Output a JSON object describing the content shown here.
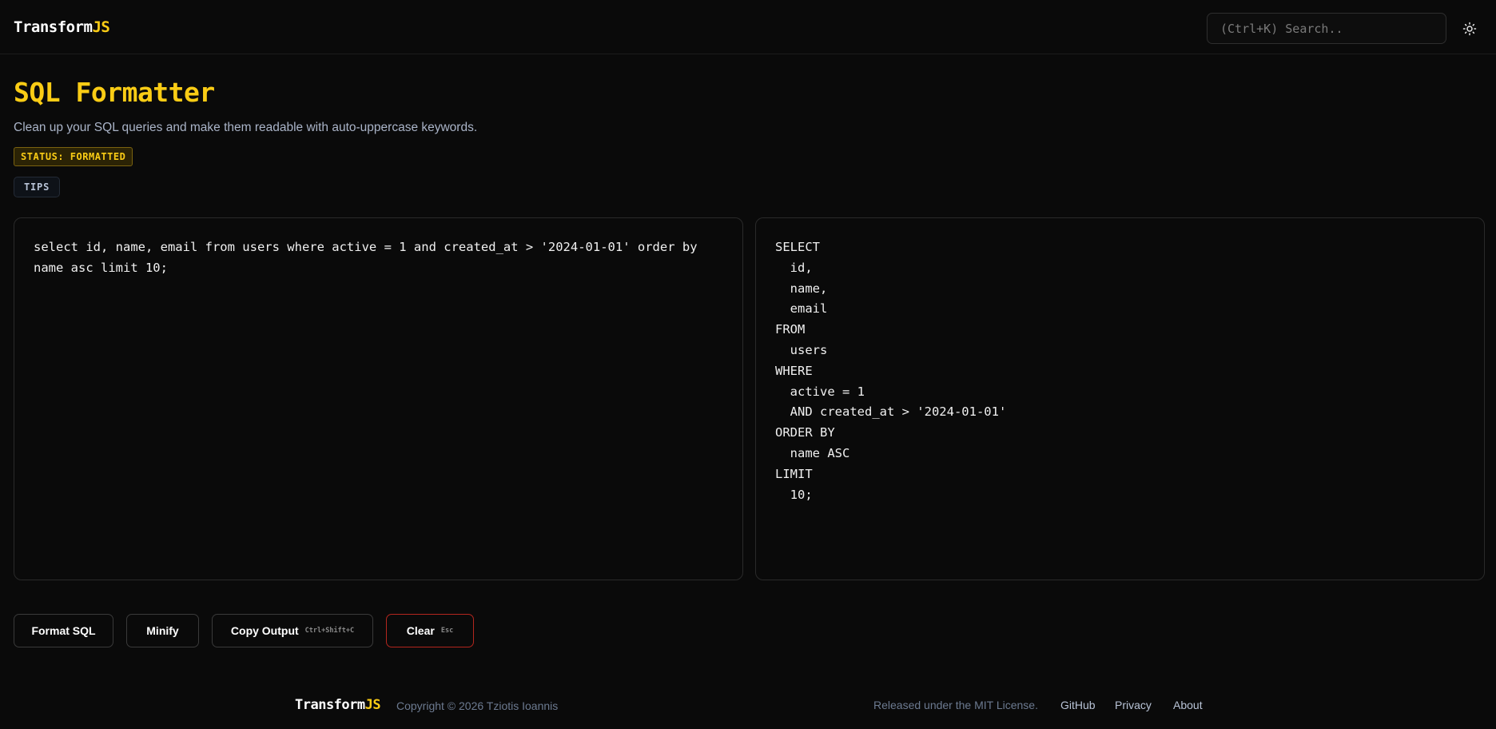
{
  "header": {
    "logo_main": "Transform",
    "logo_accent": "JS",
    "search_placeholder": "(Ctrl+K) Search..",
    "theme_icon": "sun-icon"
  },
  "page": {
    "title": "SQL Formatter",
    "description": "Clean up your SQL queries and make them readable with auto-uppercase keywords.",
    "status": "STATUS: FORMATTED",
    "tips_label": "TIPS"
  },
  "editor": {
    "input": "select id, name, email from users where active = 1 and created_at > '2024-01-01' order by name asc limit 10;",
    "output": "SELECT\n  id,\n  name,\n  email\nFROM\n  users\nWHERE\n  active = 1\n  AND created_at > '2024-01-01'\nORDER BY\n  name ASC\nLIMIT\n  10;"
  },
  "actions": {
    "format": "Format SQL",
    "minify": "Minify",
    "copy": "Copy Output",
    "copy_shortcut": "Ctrl+Shift+C",
    "clear": "Clear",
    "clear_shortcut": "Esc"
  },
  "footer": {
    "logo_main": "Transform",
    "logo_accent": "JS",
    "copyright": "Copyright © 2026 Tziotis Ioannis",
    "license": "Released under the MIT License.",
    "links": [
      "GitHub",
      "Privacy",
      "About"
    ]
  },
  "colors": {
    "accent": "#facc15",
    "background": "#0a0a0a",
    "danger": "#b3261e"
  }
}
